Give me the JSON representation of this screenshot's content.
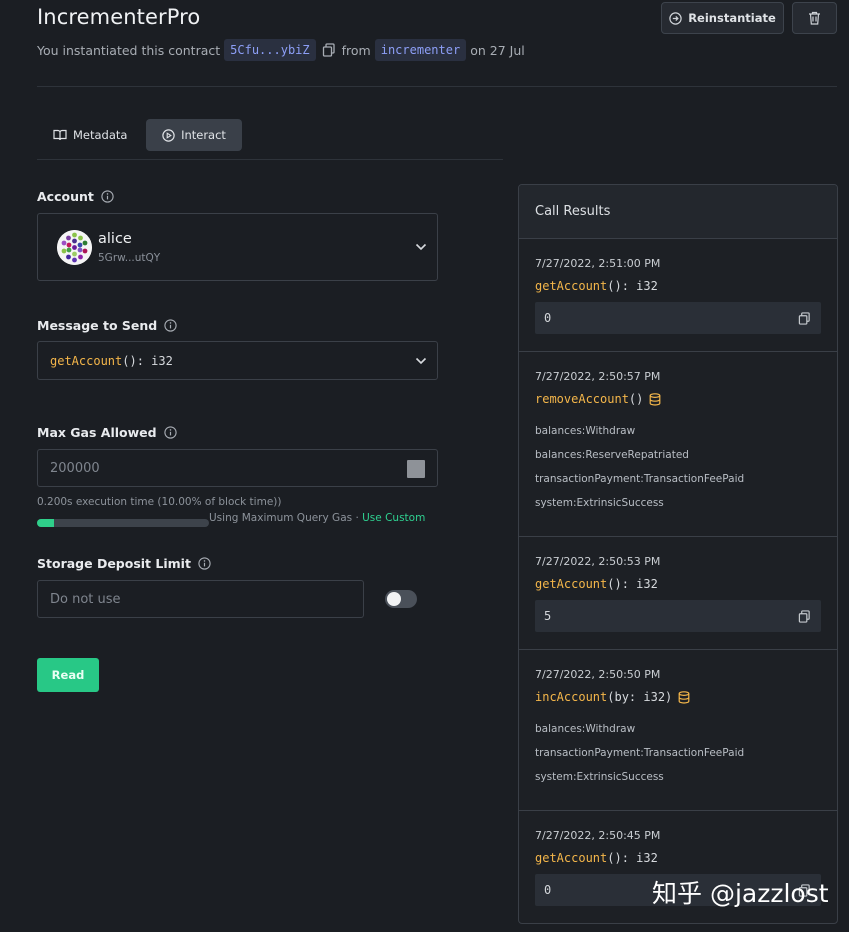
{
  "header": {
    "title": "IncrementerPro",
    "subtitle_prefix": "You instantiated this contract",
    "contract_address": "5Cfu...ybiZ",
    "from_label": "from",
    "code_name": "incrementer",
    "date_text": "on 27 Jul",
    "reinstantiate_label": "Reinstantiate"
  },
  "tabs": [
    {
      "label": "Metadata",
      "icon": "book-icon"
    },
    {
      "label": "Interact",
      "icon": "play-circle-icon",
      "active": true
    }
  ],
  "form": {
    "account_label": "Account",
    "account_name": "alice",
    "account_address": "5Grw...utQY",
    "message_label": "Message to Send",
    "message_fn": "getAccount",
    "message_sig": "(): i32",
    "gas_label": "Max Gas Allowed",
    "gas_value": "200000",
    "exec_time": "0.200s execution time (10.00% of block time))",
    "gas_usage_fraction": 0.1,
    "using_max": "Using Maximum Query Gas",
    "separator": "·",
    "use_custom": "Use Custom",
    "storage_label": "Storage Deposit Limit",
    "storage_placeholder": "Do not use",
    "storage_toggle_on": false,
    "read_label": "Read"
  },
  "results": {
    "title": "Call Results",
    "items": [
      {
        "time": "7/27/2022, 2:51:00 PM",
        "fn": "getAccount",
        "sig": "(): i32",
        "value": "0"
      },
      {
        "time": "7/27/2022, 2:50:57 PM",
        "fn": "removeAccount",
        "sig": "()",
        "tx": true,
        "events": [
          "balances:Withdraw",
          "balances:ReserveRepatriated",
          "transactionPayment:TransactionFeePaid",
          "system:ExtrinsicSuccess"
        ]
      },
      {
        "time": "7/27/2022, 2:50:53 PM",
        "fn": "getAccount",
        "sig": "(): i32",
        "value": "5"
      },
      {
        "time": "7/27/2022, 2:50:50 PM",
        "fn": "incAccount",
        "sig": "(by: i32)",
        "tx": true,
        "events": [
          "balances:Withdraw",
          "transactionPayment:TransactionFeePaid",
          "system:ExtrinsicSuccess"
        ]
      },
      {
        "time": "7/27/2022, 2:50:45 PM",
        "fn": "getAccount",
        "sig": "(): i32",
        "value": "0"
      }
    ]
  },
  "watermark": "知乎 @jazzlost",
  "colors": {
    "background": "#1b1e23",
    "accent_green": "#28c886",
    "function_orange": "#f4b64a",
    "chip_text": "#8d9ff7"
  }
}
